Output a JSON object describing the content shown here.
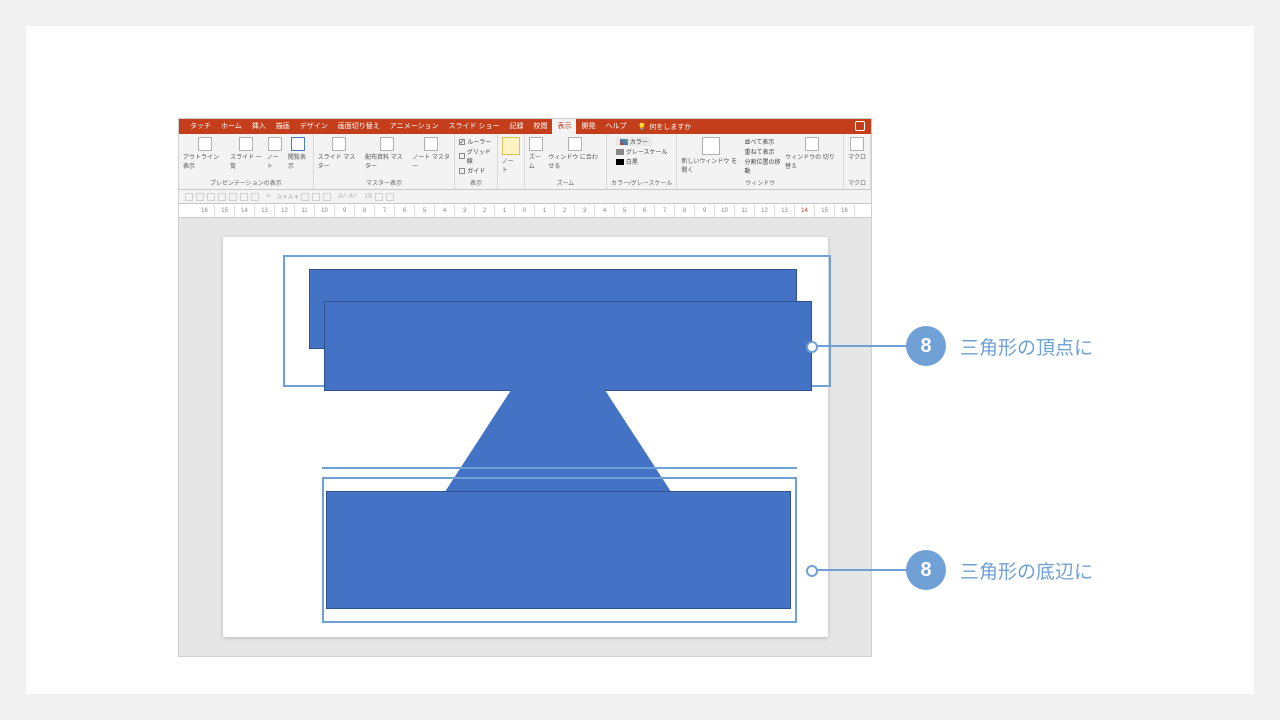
{
  "ribbon": {
    "tabs": [
      "タッチ",
      "ホーム",
      "挿入",
      "描画",
      "デザイン",
      "画面切り替え",
      "アニメーション",
      "スライド ショー",
      "記録",
      "校閲",
      "表示",
      "開発",
      "ヘルプ"
    ],
    "active_tab_index": 10,
    "tell_me": "何をしますか",
    "groups": {
      "presentation_views": {
        "label": "プレゼンテーションの表示",
        "items": [
          "アウトライン\n表示",
          "スライド\n一覧",
          "ノー\nト",
          "閲覧表示"
        ]
      },
      "master_views": {
        "label": "マスター表示",
        "items": [
          "スライド\nマスター",
          "配布資料\nマスター",
          "ノート\nマスター"
        ]
      },
      "show": {
        "label": "表示",
        "ruler": "ルーラー",
        "gridlines": "グリッド線",
        "guides": "ガイド",
        "ruler_checked": true,
        "gridlines_checked": false,
        "guides_checked": false
      },
      "notes_btn": "ノー\nト",
      "zoom": {
        "label": "ズーム",
        "zoom": "ズーム",
        "fit": "ウィンドウ\nに合わせる"
      },
      "color": {
        "label": "カラー/グレースケール",
        "color": "カラー",
        "grayscale": "グレースケール",
        "bw": "白黒"
      },
      "window": {
        "label": "ウィンドウ",
        "new": "新しいウィンドウ\nを開く",
        "arrange": "並べて表示",
        "cascade": "重ねて表示",
        "split": "分割位置の移動",
        "switch": "ウィンドウの\n切り替え"
      },
      "macros": {
        "label": "マクロ",
        "macro": "マクロ"
      }
    }
  },
  "ruler": {
    "ticks_left": [
      "16",
      "15",
      "14",
      "13",
      "12",
      "11",
      "10",
      "9",
      "8",
      "7",
      "6",
      "5",
      "4",
      "3",
      "2",
      "1",
      "0"
    ],
    "ticks_right": [
      "1",
      "2",
      "3",
      "4",
      "5",
      "6",
      "7",
      "8",
      "9",
      "10",
      "11",
      "12",
      "13",
      "14",
      "15",
      "16"
    ],
    "highlight_value": "14"
  },
  "font_size_display": "18",
  "callouts": {
    "top": {
      "number": "8",
      "text": "三角形の頂点に"
    },
    "bottom": {
      "number": "8",
      "text": "三角形の底辺に"
    }
  }
}
